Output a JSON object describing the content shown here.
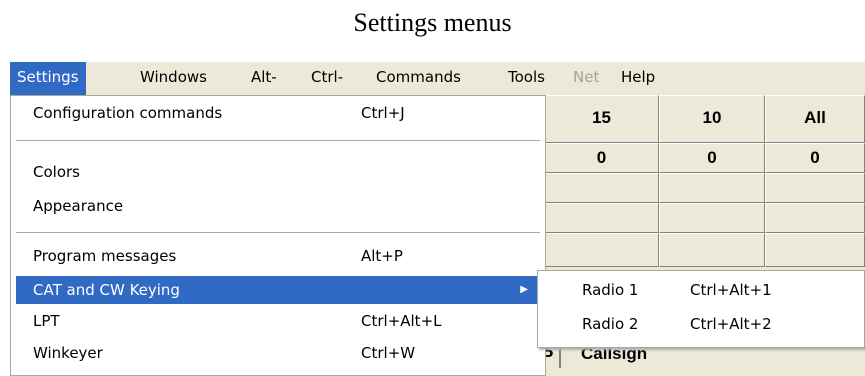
{
  "caption": "Settings menus",
  "menubar": {
    "items": [
      {
        "label": "Settings",
        "state": "active"
      },
      {
        "label": "Windows",
        "state": "normal"
      },
      {
        "label": "Alt-",
        "state": "normal"
      },
      {
        "label": "Ctrl-",
        "state": "normal"
      },
      {
        "label": "Commands",
        "state": "normal"
      },
      {
        "label": "Tools",
        "state": "normal"
      },
      {
        "label": "Net",
        "state": "disabled"
      },
      {
        "label": "Help",
        "state": "normal"
      }
    ]
  },
  "settings_menu": {
    "items": [
      {
        "label": "Configuration commands",
        "shortcut": "Ctrl+J"
      },
      {
        "label": "Colors",
        "shortcut": ""
      },
      {
        "label": "Appearance",
        "shortcut": ""
      },
      {
        "label": "Program messages",
        "shortcut": "Alt+P"
      },
      {
        "label": "CAT and CW Keying",
        "shortcut": "",
        "submenu": true
      },
      {
        "label": "LPT",
        "shortcut": "Ctrl+Alt+L"
      },
      {
        "label": "Winkeyer",
        "shortcut": "Ctrl+W"
      }
    ]
  },
  "submenu": {
    "items": [
      {
        "label": "Radio 1",
        "shortcut": "Ctrl+Alt+1"
      },
      {
        "label": "Radio 2",
        "shortcut": "Ctrl+Alt+2"
      }
    ]
  },
  "background_grid": {
    "headers": [
      "15",
      "10",
      "All"
    ],
    "values": [
      "0",
      "0",
      "0"
    ],
    "callsign_label": "Callsign",
    "callsign_stub": "5"
  },
  "colors": {
    "highlight": "#316ac5",
    "menubar_bg": "#ece9d8",
    "disabled_text": "#a4a396"
  },
  "icons": {
    "submenu_arrow": "triangle-right-icon"
  }
}
